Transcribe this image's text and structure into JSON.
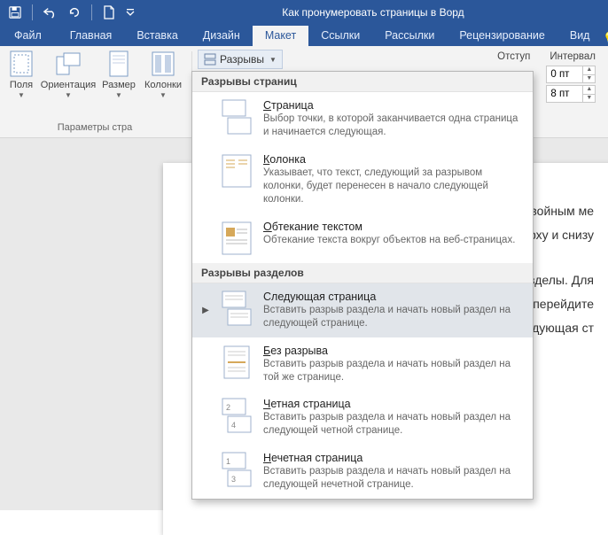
{
  "titlebar": {
    "doc_title": "Как пронумеровать страницы в Ворд"
  },
  "tabs": {
    "file": "Файл",
    "items": [
      "Главная",
      "Вставка",
      "Дизайн",
      "Макет",
      "Ссылки",
      "Рассылки",
      "Рецензирование",
      "Вид"
    ],
    "active_index": 3
  },
  "ribbon": {
    "margins": "Поля",
    "orientation": "Ориентация",
    "size": "Размер",
    "columns": "Колонки",
    "group_page_setup": "Параметры стра",
    "breaks_button": "Разрывы",
    "indent_label": "Отступ",
    "spacing_label": "Интервал",
    "spacing_before": "0 пт",
    "spacing_after": "8 пт"
  },
  "dropdown": {
    "section_page_breaks": "Разрывы страниц",
    "section_section_breaks": "Разрывы разделов",
    "items_page": [
      {
        "title_u": "С",
        "title_rest": "траница",
        "desc": "Выбор точки, в которой заканчивается одна страница и начинается следующая."
      },
      {
        "title_u": "К",
        "title_rest": "олонка",
        "desc": "Указывает, что текст, следующий за разрывом колонки, будет перенесен в начало следующей колонки."
      },
      {
        "title_u": "О",
        "title_rest": "бтекание текстом",
        "desc": "Обтекание текста вокруг объектов на веб-страницах."
      }
    ],
    "items_section": [
      {
        "title_u": "",
        "title_rest": "Следующая страница",
        "desc": "Вставить разрыв раздела и начать новый раздел на следующей странице.",
        "selected": true
      },
      {
        "title_u": "Б",
        "title_rest": "ез разрыва",
        "desc": "Вставить разрыв раздела и начать новый раздел на той же странице."
      },
      {
        "title_u": "Ч",
        "title_rest": "етная страница",
        "desc": "Вставить разрыв раздела и начать новый раздел на следующей четной странице."
      },
      {
        "title_u": "Н",
        "title_rest": "ечетная страница",
        "desc": "Вставить разрыв раздела и начать новый раздел на следующей нечетной странице."
      }
    ]
  },
  "document": {
    "p1_tail": " двойным ме",
    "p2_tail": "верху и снизу",
    "p3_tail": "разделы. Для",
    "p4_tail": "rd перейдите",
    "p5_tail": "Следующая ст"
  }
}
